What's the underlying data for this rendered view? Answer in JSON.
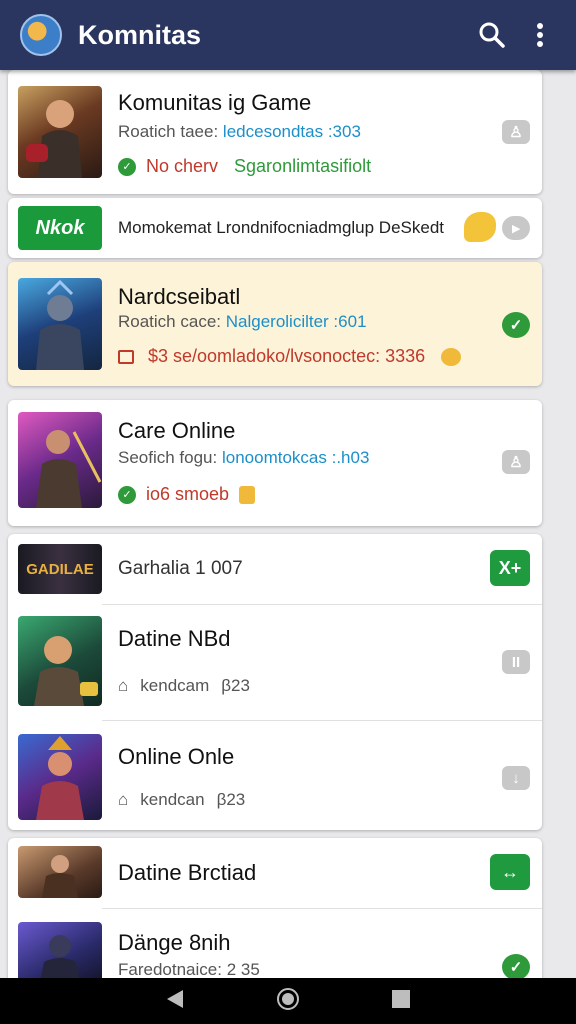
{
  "app": {
    "title": "Komnitas"
  },
  "cards": [
    {
      "title": "Komunitas ig Game",
      "sub_label": "Roatich taee:",
      "sub_link": "ledcesondtas :303",
      "status_left": "No cherv",
      "status_right": "Sgaronlimtasifiolt"
    },
    {
      "banner_logo": "Nkok",
      "banner_text": "Momokemat Lrondnifocniadmglup DeSkedt"
    },
    {
      "title": "Nardcseibatl",
      "sub_label": "Roatich cace:",
      "sub_link": "Nalgerolicilter :601",
      "row3": "$3 se/oomladoko/lvsonoctec: 3336"
    },
    {
      "title": "Care Online",
      "sub_label": "Seofich fogu:",
      "sub_link": "lonoomtokcas :.h03",
      "row3": "io6 smoeb"
    }
  ],
  "list": [
    {
      "title": "Garhalia 1 007",
      "thumb_text": "GADILAE",
      "button": "X+"
    },
    {
      "title": "Datine NBd",
      "meta": "kendcam",
      "count": "β23"
    },
    {
      "title": "Online Onle",
      "meta": "kendcan",
      "count": "β23"
    }
  ],
  "bottom": [
    {
      "title": "Datine Brctiad"
    },
    {
      "title": "Dänge 8nih",
      "sub": "Faredotnaice:",
      "sub_count": "2 35"
    }
  ],
  "colors": {
    "appbar": "#2a3560",
    "accent_green": "#1f9a3f",
    "link_blue": "#1c8fc9",
    "price_red": "#c0392b"
  },
  "icons": [
    "search-icon",
    "more-vert-icon",
    "back-icon",
    "home-icon",
    "recents-icon"
  ]
}
